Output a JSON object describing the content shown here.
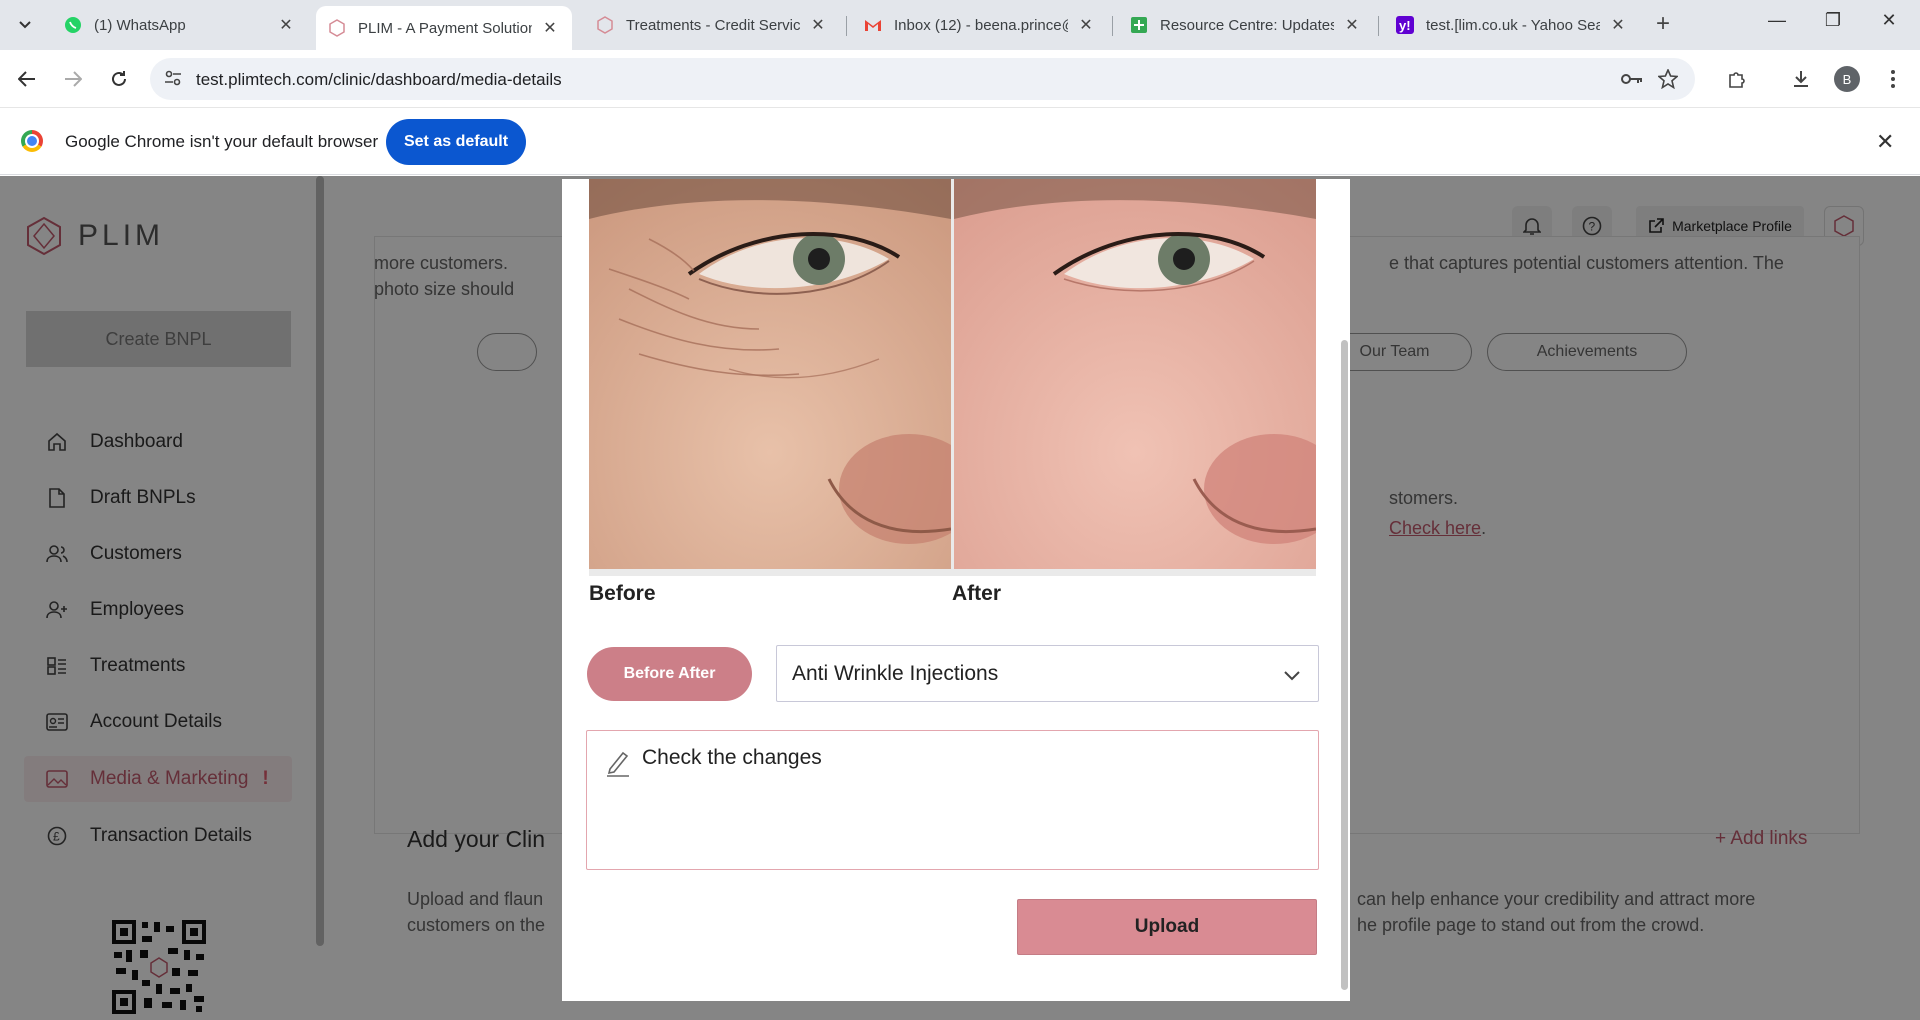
{
  "browser": {
    "tabs": [
      {
        "title": "(1) WhatsApp",
        "favicon": "whatsapp-icon",
        "active": false
      },
      {
        "title": "PLIM - A Payment Solution",
        "favicon": "plim-icon",
        "active": true
      },
      {
        "title": "Treatments - Credit Service",
        "favicon": "plim-icon",
        "active": false
      },
      {
        "title": "Inbox (12) - beena.prince@",
        "favicon": "gmail-icon",
        "active": false
      },
      {
        "title": "Resource Centre: Updates",
        "favicon": "sheets-icon",
        "active": false
      },
      {
        "title": "test.[lim.co.uk - Yahoo Sear",
        "favicon": "yahoo-icon",
        "active": false
      }
    ],
    "url": "test.plimtech.com/clinic/dashboard/media-details",
    "profile_initial": "B"
  },
  "infobar": {
    "message": "Google Chrome isn't your default browser",
    "button": "Set as default"
  },
  "sidebar": {
    "brand": "PLIM",
    "create_button": "Create BNPL",
    "items": [
      {
        "label": "Dashboard",
        "icon": "home-icon"
      },
      {
        "label": "Draft BNPLs",
        "icon": "document-icon"
      },
      {
        "label": "Customers",
        "icon": "users-icon"
      },
      {
        "label": "Employees",
        "icon": "user-plus-icon"
      },
      {
        "label": "Treatments",
        "icon": "grid-icon"
      },
      {
        "label": "Account Details",
        "icon": "id-card-icon"
      },
      {
        "label": "Media & Marketing",
        "icon": "image-icon",
        "active": true,
        "alert": "!"
      },
      {
        "label": "Transaction Details",
        "icon": "pound-icon"
      }
    ]
  },
  "header": {
    "marketplace_button": "Marketplace Profile"
  },
  "background": {
    "intro_left_1": "more customers.",
    "intro_left_2": "photo size should",
    "intro_right": "e that captures potential customers attention. The",
    "pill_team": "Our Team",
    "pill_achievements": "Achievements",
    "customers_text": "stomers.",
    "check_here": "Check here",
    "period": ".",
    "heading": "Add your Clin",
    "add_links": "+ Add links",
    "para_left_1": "Upload and flaun",
    "para_left_2": "customers on the",
    "para_right_1": "can help enhance your credibility and attract more",
    "para_right_2": "he profile page to stand out from the crowd."
  },
  "modal": {
    "before_label": "Before",
    "after_label": "After",
    "type_button": "Before After",
    "treatment_select": "Anti Wrinkle Injections",
    "note_text": "Check the changes",
    "upload_button": "Upload"
  },
  "colors": {
    "accent": "#cc7f88",
    "upload": "#d98b93",
    "chrome_blue": "#0b57d0"
  }
}
